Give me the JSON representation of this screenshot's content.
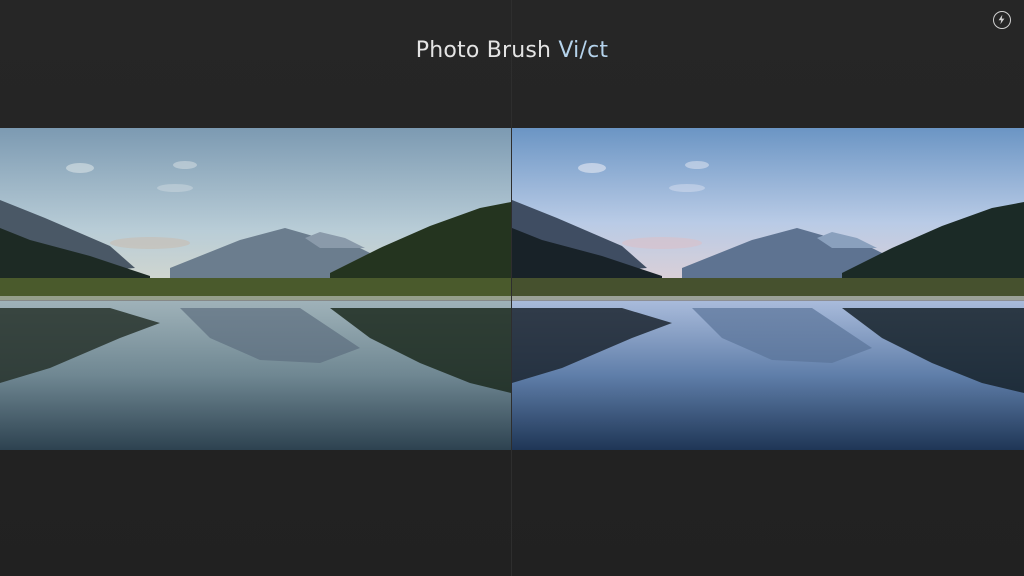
{
  "app": {
    "title_main": "Photo Brush ",
    "title_accent": "Vi/ct",
    "accent_color": "#b5d3ec"
  },
  "toolbar": {
    "corner_icon": "bolt-circle-icon"
  },
  "comparison": {
    "left_panel": "original-photo",
    "right_panel": "edited-photo"
  }
}
